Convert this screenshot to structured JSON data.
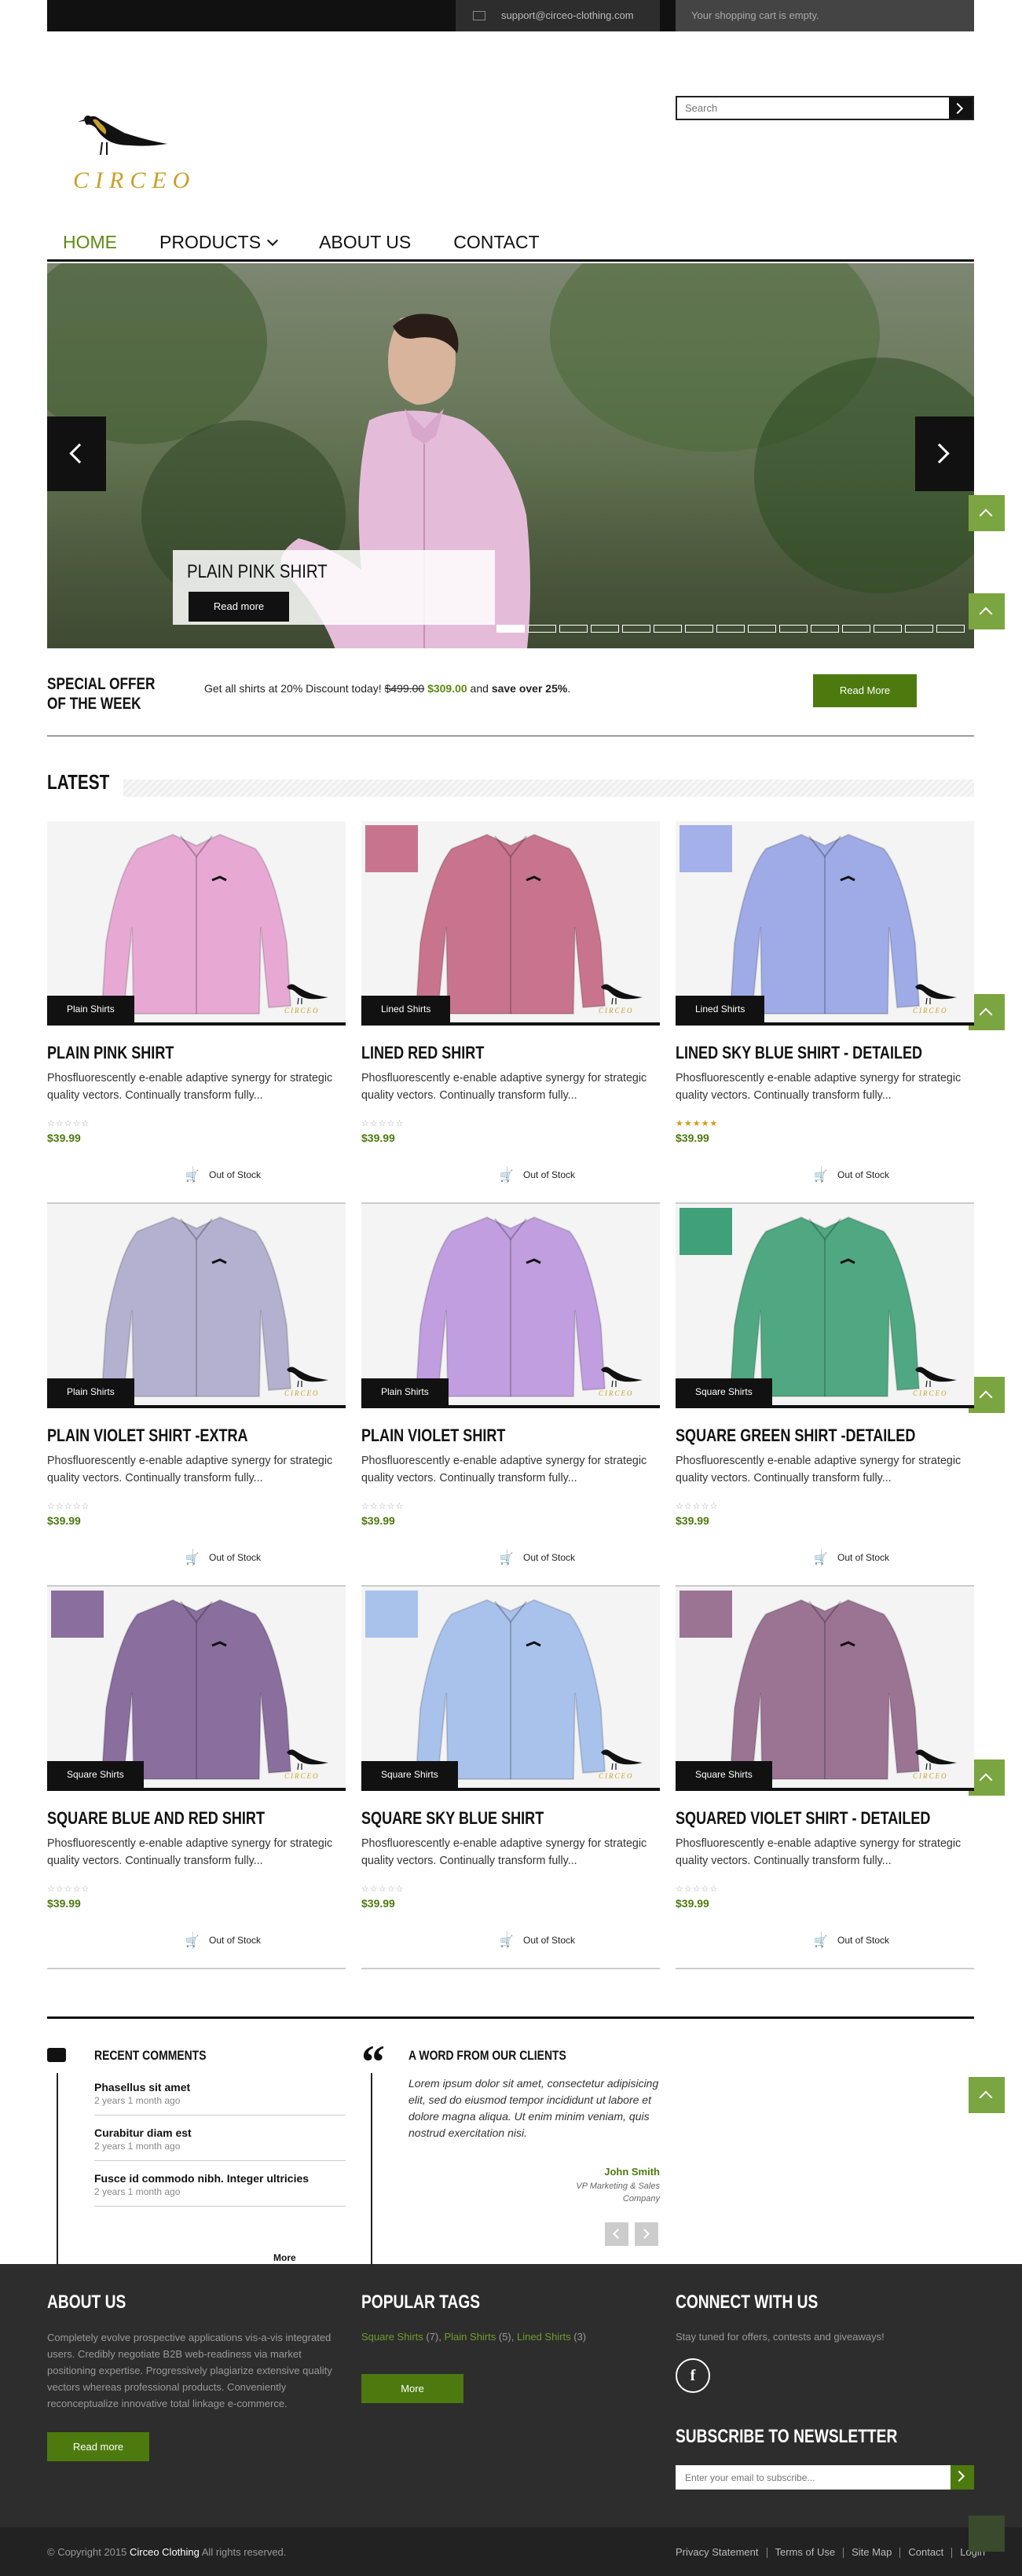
{
  "topbar": {
    "email": "support@circeo-clothing.com",
    "cart": "Your shopping cart is empty."
  },
  "logo": {
    "brand": "CIRCEO"
  },
  "search": {
    "placeholder": "Search"
  },
  "nav": {
    "items": [
      "HOME",
      "PRODUCTS",
      "ABOUT US",
      "CONTACT"
    ]
  },
  "slider": {
    "caption": "PLAIN PINK SHIRT",
    "button": "Read more",
    "dots": 15,
    "active_dot": 0
  },
  "offer": {
    "title": "SPECIAL OFFER OF THE WEEK",
    "text": "Get all shirts at  20% Discount today! ",
    "old_price": "$499.00",
    "new_price": "$309.00",
    "and": " and ",
    "save": "save over 25%",
    "end": ".",
    "button": "Read More"
  },
  "latest": {
    "title": "LATEST"
  },
  "products": [
    {
      "name": "PLAIN PINK SHIRT",
      "category": "Plain Shirts",
      "desc": "Phosfluorescently e-enable adaptive synergy for strategic quality vectors. Continually transform fully...",
      "price": "$39.99",
      "stock": "Out of Stock",
      "stars": "☆☆☆☆☆",
      "rated": false,
      "color": "#e7a9d3",
      "swatch": ""
    },
    {
      "name": "LINED RED SHIRT",
      "category": "Lined Shirts",
      "desc": "Phosfluorescently e-enable adaptive synergy for strategic quality vectors. Continually transform fully...",
      "price": "$39.99",
      "stock": "Out of Stock",
      "stars": "☆☆☆☆☆",
      "rated": false,
      "color": "#c9748f",
      "swatch": "#c9748f"
    },
    {
      "name": "LINED SKY BLUE SHIRT - DETAILED",
      "category": "Lined Shirts",
      "desc": "Phosfluorescently e-enable adaptive synergy for strategic quality vectors. Continually transform fully...",
      "price": "$39.99",
      "stock": "Out of Stock",
      "stars": "★★★★★",
      "rated": true,
      "color": "#9eabe6",
      "swatch": "#a3b0ea"
    },
    {
      "name": "PLAIN VIOLET SHIRT -EXTRA",
      "category": "Plain Shirts",
      "desc": "Phosfluorescently e-enable adaptive synergy for strategic quality vectors. Continually transform fully...",
      "price": "$39.99",
      "stock": "Out of Stock",
      "stars": "☆☆☆☆☆",
      "rated": false,
      "color": "#b4b0cf",
      "swatch": ""
    },
    {
      "name": "PLAIN VIOLET SHIRT",
      "category": "Plain Shirts",
      "desc": "Phosfluorescently e-enable adaptive synergy for strategic quality vectors. Continually transform fully...",
      "price": "$39.99",
      "stock": "Out of Stock",
      "stars": "☆☆☆☆☆",
      "rated": false,
      "color": "#c19ee0",
      "swatch": ""
    },
    {
      "name": "SQUARE GREEN SHIRT -DETAILED",
      "category": "Square Shirts",
      "desc": "Phosfluorescently e-enable adaptive synergy for strategic quality vectors. Continually transform fully...",
      "price": "$39.99",
      "stock": "Out of Stock",
      "stars": "☆☆☆☆☆",
      "rated": false,
      "color": "#4fa882",
      "swatch": "#3fa07a"
    },
    {
      "name": "SQUARE BLUE AND RED SHIRT",
      "category": "Square Shirts",
      "desc": "Phosfluorescently e-enable adaptive synergy for strategic quality vectors. Continually transform fully...",
      "price": "$39.99",
      "stock": "Out of Stock",
      "stars": "☆☆☆☆☆",
      "rated": false,
      "color": "#8a6e9e",
      "swatch": "#8a6e9e"
    },
    {
      "name": "SQUARE SKY BLUE SHIRT",
      "category": "Square Shirts",
      "desc": "Phosfluorescently e-enable adaptive synergy for strategic quality vectors. Continually transform fully...",
      "price": "$39.99",
      "stock": "Out of Stock",
      "stars": "☆☆☆☆☆",
      "rated": false,
      "color": "#a8c2ec",
      "swatch": "#a8c2ec"
    },
    {
      "name": "SQUARED VIOLET SHIRT - DETAILED",
      "category": "Square Shirts",
      "desc": "Phosfluorescently e-enable adaptive synergy for strategic quality vectors. Continually transform fully...",
      "price": "$39.99",
      "stock": "Out of Stock",
      "stars": "☆☆☆☆☆",
      "rated": false,
      "color": "#9b7493",
      "swatch": "#9b7493"
    }
  ],
  "comments": {
    "title": "RECENT COMMENTS",
    "items": [
      {
        "title": "Phasellus sit amet",
        "time": "2 years 1 month ago"
      },
      {
        "title": "Curabitur diam est",
        "time": "2 years 1 month ago"
      },
      {
        "title": "Fusce id commodo nibh. Integer ultricies",
        "time": "2 years 1 month ago"
      }
    ],
    "more": "More comments"
  },
  "clients": {
    "title": "A WORD FROM OUR CLIENTS",
    "quote": "Lorem ipsum dolor sit amet, consectetur adipisicing elit, sed do eiusmod tempor incididunt ut labore et dolore magna aliqua. Ut enim minim veniam, quis nostrud exercitation nisi.",
    "name": "John Smith",
    "role": "VP Marketing & Sales Company"
  },
  "footer": {
    "about_title": "ABOUT US",
    "about_text": "Completely evolve prospective applications vis-a-vis integrated users. Credibly negotiate B2B web-readiness via market positioning expertise. Progressively plagiarize extensive quality vectors whereas professional products. Conveniently reconceptualize innovative total linkage e-commerce.",
    "about_button": "Read more",
    "tags_title": "POPULAR TAGS",
    "tags": [
      {
        "label": "Square Shirts",
        "count": " (7), "
      },
      {
        "label": "Plain Shirts",
        "count": " (5), "
      },
      {
        "label": "Lined Shirts",
        "count": " (3)"
      }
    ],
    "tags_button": "More",
    "connect_title": "CONNECT WITH US",
    "connect_text": "Stay tuned for offers, contests and giveaways!",
    "fb": "f",
    "newsletter_title": "SUBSCRIBE TO NEWSLETTER",
    "newsletter_placeholder": "Enter your email to subscribe..."
  },
  "copyright": {
    "prefix": "© Copyright 2015 ",
    "brand": "Circeo Clothing",
    "suffix": " All rights reserved.",
    "links": [
      "Privacy Statement",
      "Terms of Use",
      "Site Map",
      "Contact",
      "Login"
    ]
  },
  "colors": {
    "accent": "#4d7a0e",
    "dark": "#111111",
    "footer": "#2d2d2d"
  }
}
